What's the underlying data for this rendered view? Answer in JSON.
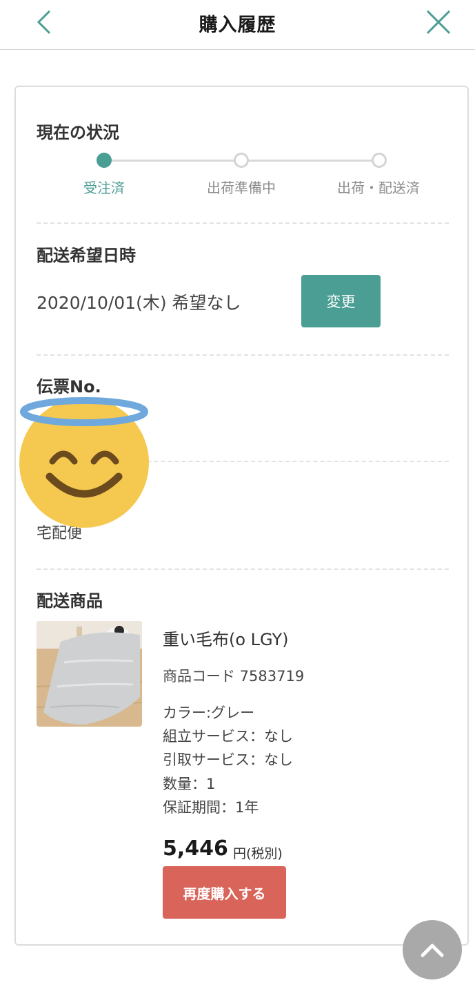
{
  "header": {
    "title": "購入履歴",
    "back_icon": "chevron-left-icon",
    "close_icon": "close-icon"
  },
  "status": {
    "title": "現在の状況",
    "steps": [
      {
        "label": "受注済",
        "active": true
      },
      {
        "label": "出荷準備中",
        "active": false
      },
      {
        "label": "出荷・配送済",
        "active": false
      }
    ]
  },
  "delivery": {
    "title": "配送希望日時",
    "value": "2020/10/01(木) 希望なし",
    "change_label": "変更"
  },
  "slip": {
    "title": "伝票No."
  },
  "shipping": {
    "method": "宅配便"
  },
  "product": {
    "section_title": "配送商品",
    "name": "重い毛布(o LGY)",
    "code": "商品コード 7583719",
    "attributes": [
      "カラー:グレー",
      "組立サービス：なし",
      "引取サービス：なし",
      "数量：1",
      "保証期間：1年"
    ],
    "price": "5,446",
    "price_unit": "円(税別)",
    "rebuy_label": "再度購入する"
  },
  "colors": {
    "accent": "#4a9e94",
    "rebuy": "#d9645a",
    "emoji_face": "#f5c94f",
    "emoji_halo": "#6fa8dc"
  },
  "overlay": {
    "emoji_icon": "smiling-face-with-halo-icon",
    "to_top_icon": "chevron-up-icon"
  }
}
